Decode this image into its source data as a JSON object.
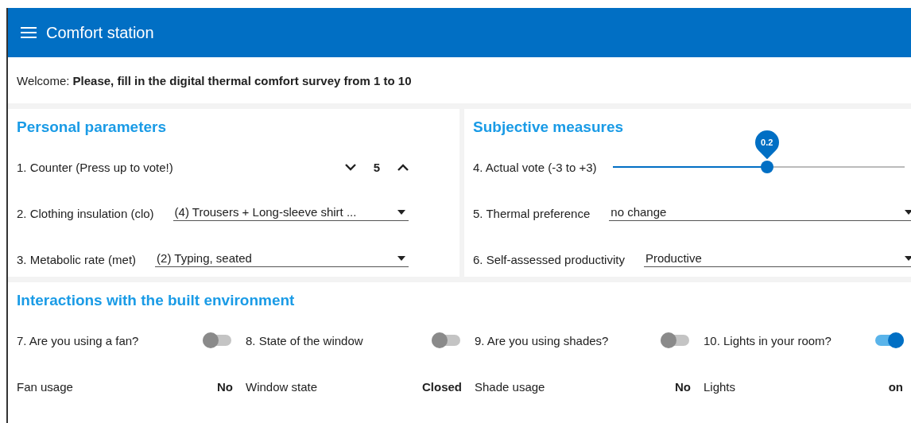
{
  "header": {
    "title": "Comfort station"
  },
  "welcome": "Welcome: **Please, fill in the digital thermal comfort survey from 1 to 10**",
  "personal": {
    "title": "Personal parameters",
    "items": [
      {
        "kind": "counter",
        "label": "1. Counter (Press up to vote!)",
        "value": "5"
      },
      {
        "kind": "select",
        "label": "2. Clothing insulation (clo)",
        "value": "(4) Trousers + Long-sleeve shirt ..."
      },
      {
        "kind": "select",
        "label": "3. Metabolic rate (met)",
        "value": "(2) Typing, seated"
      }
    ]
  },
  "subjective": {
    "title": "Subjective measures",
    "items": [
      {
        "kind": "slider",
        "label": "4. Actual vote (-3 to +3)",
        "reading": "0.2",
        "level": 0.53
      },
      {
        "kind": "select",
        "label": "5. Thermal preference",
        "value": "no change"
      },
      {
        "kind": "select",
        "label": "6. Self-assessed productivity",
        "value": "Productive"
      }
    ]
  },
  "interactions": {
    "title": "Interactions with the built environment",
    "questions": [
      {
        "label": "7. Are you using a fan?",
        "on": false
      },
      {
        "label": "8. State of the window",
        "on": false
      },
      {
        "label": "9. Are you using shades?",
        "on": false
      },
      {
        "label": "10. Lights in your room?",
        "on": true
      }
    ],
    "readouts": [
      {
        "label": "Fan usage",
        "value": "No"
      },
      {
        "label": "Window state",
        "value": "Closed"
      },
      {
        "label": "Shade usage",
        "value": "No"
      },
      {
        "label": "Lights",
        "value": "on"
      }
    ]
  }
}
